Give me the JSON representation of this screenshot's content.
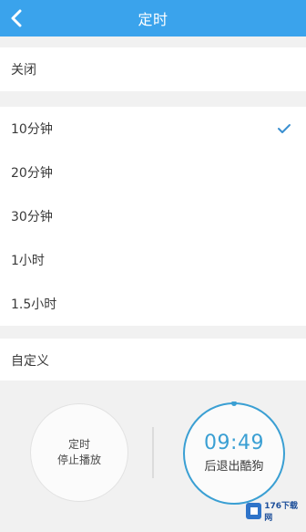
{
  "header": {
    "title": "定时",
    "back_icon": "chevron-left-icon"
  },
  "options": [
    {
      "label": "关闭",
      "selected": false
    },
    {
      "label": "10分钟",
      "selected": true
    },
    {
      "label": "20分钟",
      "selected": false
    },
    {
      "label": "30分钟",
      "selected": false
    },
    {
      "label": "1小时",
      "selected": false
    },
    {
      "label": "1.5小时",
      "selected": false
    },
    {
      "label": "自定义",
      "selected": false
    }
  ],
  "stop_button": {
    "line1": "定时",
    "line2": "停止播放"
  },
  "countdown": {
    "time": "09:49",
    "label": "后退出酷狗"
  },
  "watermark": {
    "text": "176下载网"
  },
  "colors": {
    "accent": "#3aa3ec",
    "ring": "#3a9fd3"
  }
}
